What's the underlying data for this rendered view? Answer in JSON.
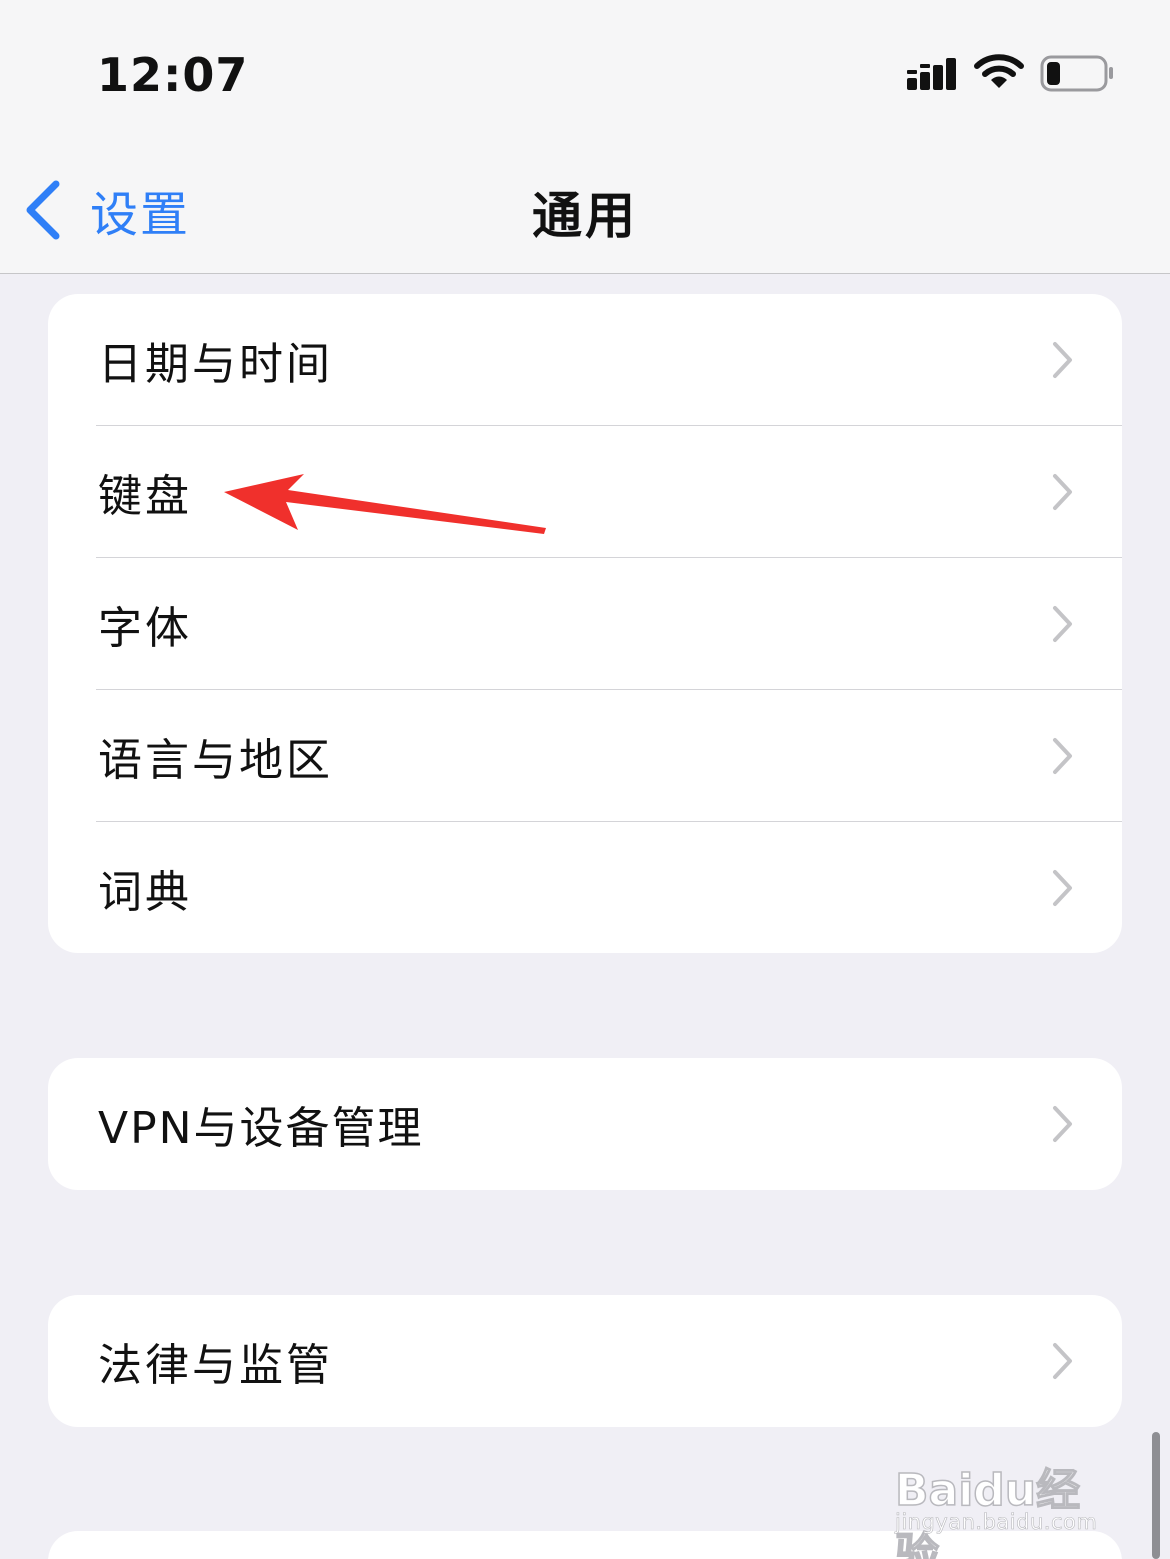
{
  "status_bar": {
    "time": "12:07"
  },
  "nav": {
    "back_label": "设置",
    "title": "通用"
  },
  "groups": [
    {
      "items": [
        {
          "label": "日期与时间"
        },
        {
          "label": "键盘"
        },
        {
          "label": "字体"
        },
        {
          "label": "语言与地区"
        },
        {
          "label": "词典"
        }
      ]
    },
    {
      "items": [
        {
          "label": "VPN与设备管理"
        }
      ]
    },
    {
      "items": [
        {
          "label": "法律与监管"
        }
      ]
    }
  ],
  "annotation": {
    "target": "键盘",
    "color": "#f0302c"
  },
  "watermark": {
    "logo": "Baidu经验",
    "url": "jingyan.baidu.com"
  },
  "colors": {
    "accent": "#2f7ff7",
    "background": "#f0eff5",
    "chevron": "#c4c4c7"
  }
}
